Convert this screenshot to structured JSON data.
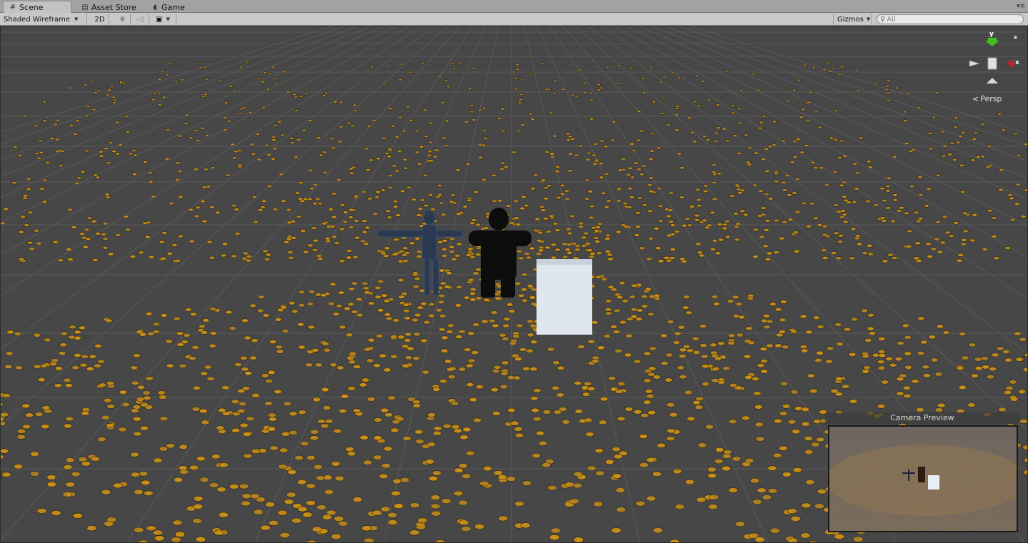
{
  "tabs": [
    {
      "label": "Scene",
      "icon": "grid-icon",
      "active": true
    },
    {
      "label": "Asset Store",
      "icon": "store-icon",
      "active": false
    },
    {
      "label": "Game",
      "icon": "pacman-icon",
      "active": false
    }
  ],
  "toolbar": {
    "draw_mode": "Shaded Wireframe",
    "mode_2d": "2D",
    "gizmos": "Gizmos",
    "search_placeholder": "All"
  },
  "gizmo": {
    "y_label": "y",
    "x_label": "x",
    "projection": "Persp"
  },
  "camera_preview": {
    "title": "Camera Preview"
  },
  "colors": {
    "scene_bg": "#474747",
    "particles": "#c8901a",
    "axis_x": "#cc2020",
    "axis_y": "#40c020",
    "cube": "#dfe6ee"
  }
}
